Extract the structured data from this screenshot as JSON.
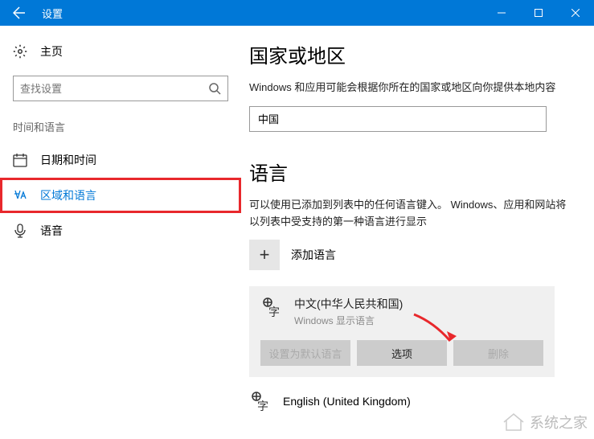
{
  "titlebar": {
    "title": "设置"
  },
  "sidebar": {
    "home": "主页",
    "search_placeholder": "查找设置",
    "section": "时间和语言",
    "items": [
      {
        "label": "日期和时间"
      },
      {
        "label": "区域和语言"
      },
      {
        "label": "语音"
      }
    ]
  },
  "main": {
    "region_heading": "国家或地区",
    "region_desc": "Windows 和应用可能会根据你所在的国家或地区向你提供本地内容",
    "country": "中国",
    "language_heading": "语言",
    "language_desc": "可以使用已添加到列表中的任何语言键入。 Windows、应用和网站将以列表中受支持的第一种语言进行显示",
    "add_language": "添加语言",
    "languages": [
      {
        "name": "中文(中华人民共和国)",
        "sub": "Windows 显示语言"
      },
      {
        "name": "English (United Kingdom)"
      }
    ],
    "buttons": {
      "set_default": "设置为默认语言",
      "options": "选项",
      "remove": "删除"
    }
  },
  "watermark": "系统之家"
}
